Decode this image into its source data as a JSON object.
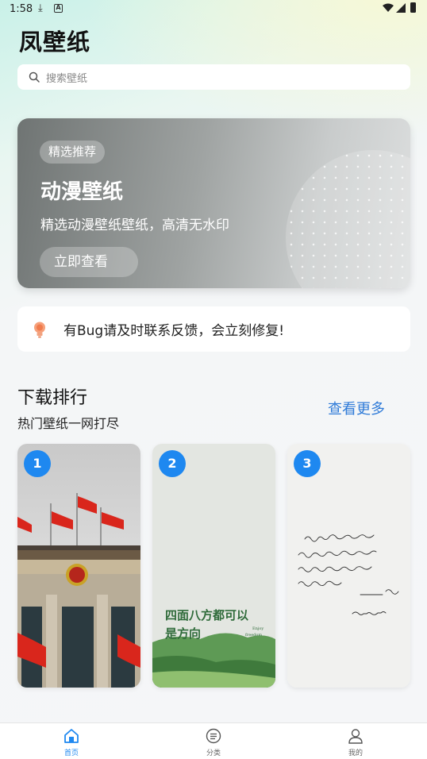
{
  "status_bar": {
    "time": "1:58",
    "download_glyph": "⤓",
    "a_glyph": "A"
  },
  "app": {
    "title": "凤壁纸"
  },
  "search": {
    "placeholder": "搜索壁纸"
  },
  "banner": {
    "tag": "精选推荐",
    "title": "动漫壁纸",
    "description": "精选动漫壁纸壁纸，高清无水印",
    "button": "立即查看"
  },
  "notice": {
    "text": "有Bug请及时联系反馈，会立刻修复!"
  },
  "ranking": {
    "title": "下载排行",
    "subtitle": "热门壁纸一网打尽",
    "more": "查看更多",
    "items": [
      {
        "rank": "1"
      },
      {
        "rank": "2",
        "slogan_line1": "四面八方都可以",
        "slogan_line2": "是方向",
        "slogan_en1": "Enjoy",
        "slogan_en2": "freedom"
      },
      {
        "rank": "3"
      }
    ]
  },
  "bottom_nav": [
    {
      "label": "首页",
      "icon": "home-icon",
      "active": true
    },
    {
      "label": "分类",
      "icon": "category-icon",
      "active": false
    },
    {
      "label": "我的",
      "icon": "profile-icon",
      "active": false
    }
  ],
  "colors": {
    "accent": "#1e88f0",
    "link": "#2f7bd8"
  }
}
